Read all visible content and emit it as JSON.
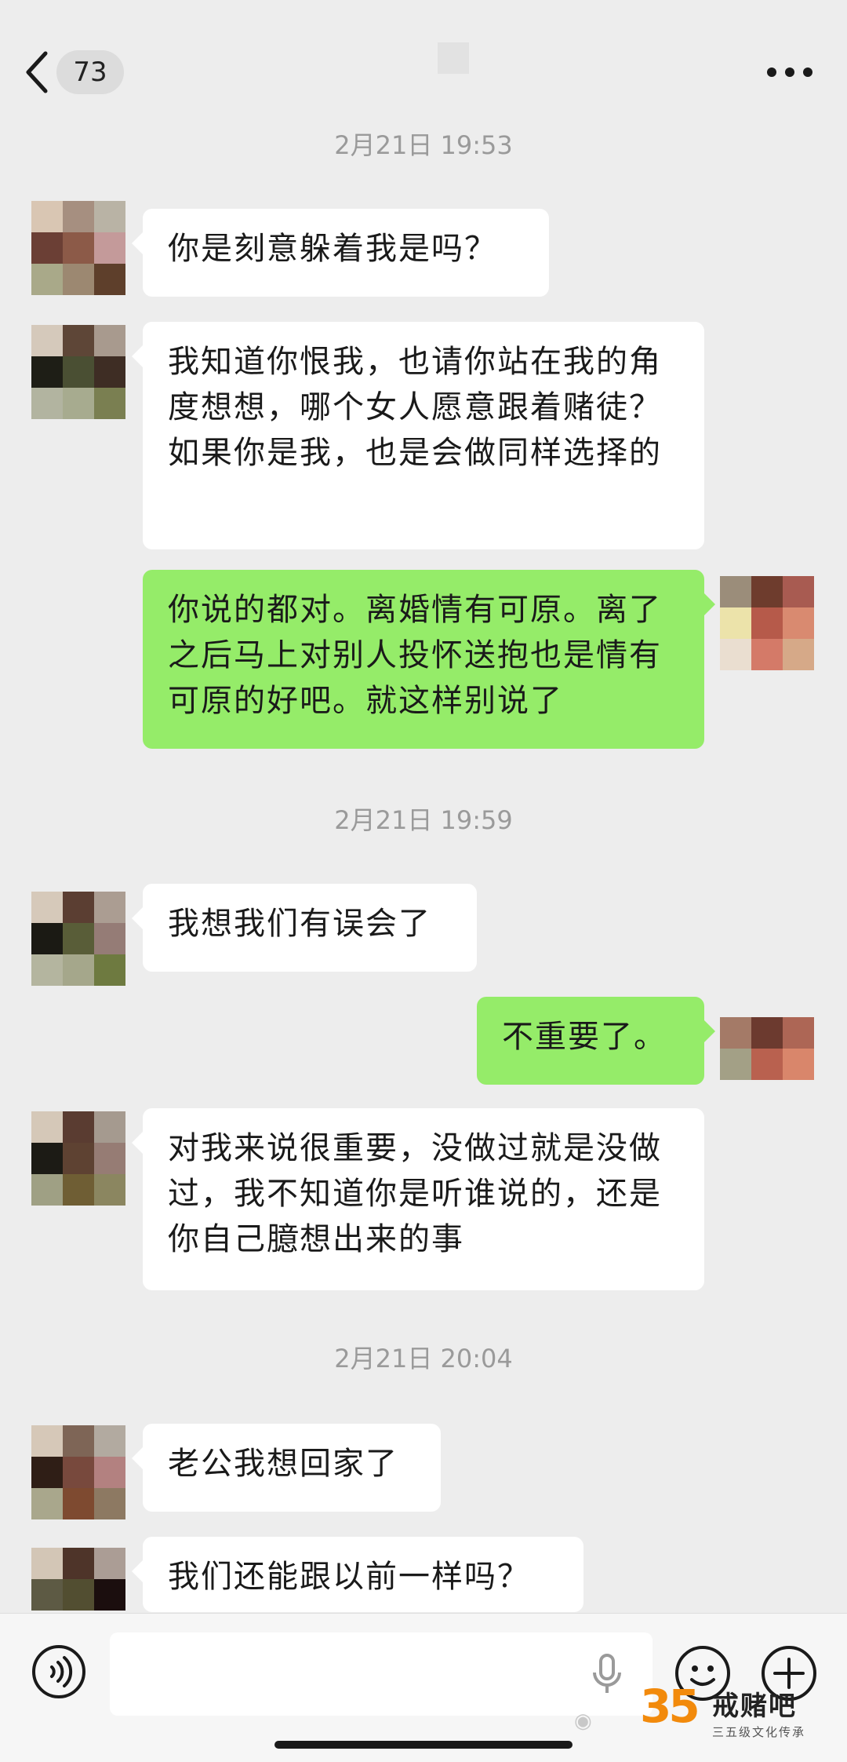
{
  "header": {
    "unread_count": "73"
  },
  "timestamps": [
    "2月21日 19:53",
    "2月21日 19:59",
    "2月21日 20:04"
  ],
  "messages": [
    {
      "side": "in",
      "text": "你是刻意躲着我是吗？"
    },
    {
      "side": "in",
      "text": "我知道你恨我，也请你站在我的角度想想，哪个女人愿意跟着赌徒？如果你是我，也是会做同样选择的"
    },
    {
      "side": "out",
      "text": "你说的都对。离婚情有可原。离了之后马上对别人投怀送抱也是情有可原的好吧。就这样别说了"
    },
    {
      "side": "in",
      "text": "我想我们有误会了"
    },
    {
      "side": "out",
      "text": "不重要了。"
    },
    {
      "side": "in",
      "text": "对我来说很重要，没做过就是没做过，我不知道你是听谁说的，还是你自己臆想出来的事"
    },
    {
      "side": "in",
      "text": "老公我想回家了"
    },
    {
      "side": "in",
      "text": "我们还能跟以前一样吗？"
    }
  ],
  "icons": {
    "back": "chevron-left-icon",
    "more": "more-dots-icon",
    "voice": "voice-icon",
    "mic": "mic-icon",
    "emoji": "emoji-icon",
    "plus": "plus-icon"
  },
  "colors": {
    "background": "#ededed",
    "incoming_bubble": "#ffffff",
    "outgoing_bubble": "#95ec69",
    "timestamp": "#9a9a9a"
  },
  "watermark": {
    "number": "35",
    "name": "戒赌吧",
    "subtitle": "三五级文化传承"
  }
}
